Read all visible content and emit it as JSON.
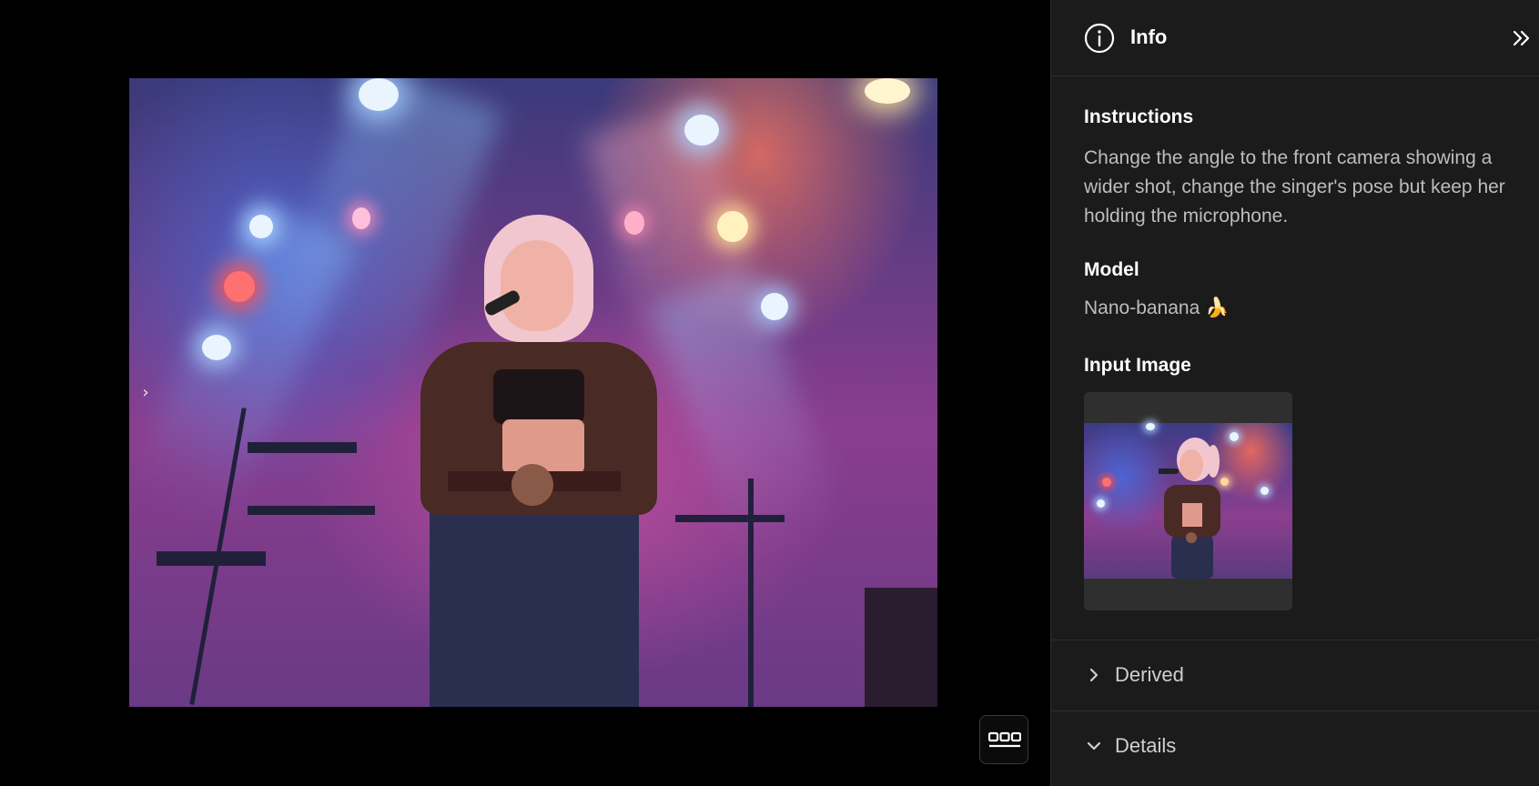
{
  "viewer": {
    "next_icon": "chevron-right-icon",
    "more_icon": "film-strip-icon"
  },
  "panel": {
    "header": {
      "icon": "info-icon",
      "title": "Info",
      "collapse_icon": "double-chevron-right-icon"
    },
    "instructions": {
      "label": "Instructions",
      "text": "Change the angle to the front camera showing a wider shot, change the singer's pose but keep her holding the microphone."
    },
    "model": {
      "label": "Model",
      "value": "Nano-banana 🍌"
    },
    "input_image": {
      "label": "Input Image"
    },
    "sections": [
      {
        "label": "Derived",
        "state": "collapsed",
        "icon": "chevron-right-icon"
      },
      {
        "label": "Details",
        "state": "expanded",
        "icon": "chevron-down-icon"
      }
    ]
  }
}
